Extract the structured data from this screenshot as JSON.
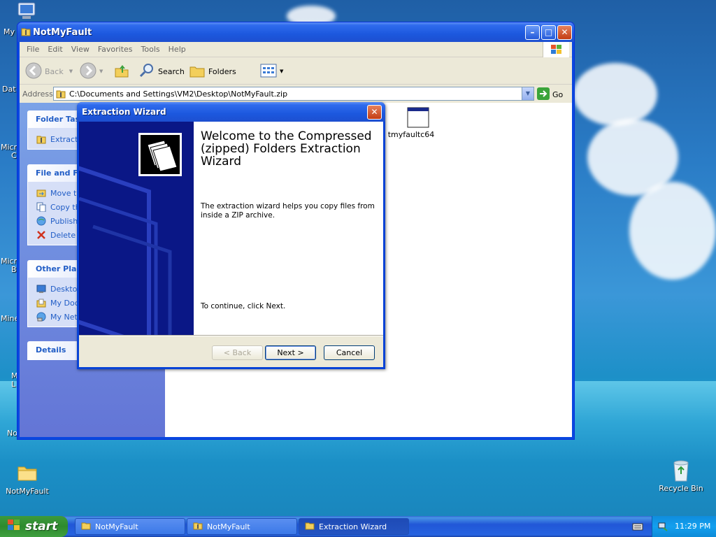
{
  "desktop": {
    "icons": {
      "my_computer_partial": "My",
      "data_partial": "Dat",
      "micro1_partial": "Micro",
      "micro1_line2_partial": "C",
      "micro2_partial": "Micro",
      "micro2_line2_partial": "B",
      "mine_partial": "Mine",
      "m_partial": "M",
      "l_partial": "L",
      "no_partial": "No",
      "notmyfault": "NotMyFault",
      "recycle_bin": "Recycle Bin"
    }
  },
  "explorer": {
    "title": "NotMyFault",
    "menu": [
      "File",
      "Edit",
      "View",
      "Favorites",
      "Tools",
      "Help"
    ],
    "toolbar": {
      "back": "Back",
      "search": "Search",
      "folders": "Folders"
    },
    "address": {
      "label": "Address",
      "value": "C:\\Documents and Settings\\VM2\\Desktop\\NotMyFault.zip",
      "go": "Go"
    },
    "left_panels": {
      "folder_tasks": {
        "title": "Folder Tas",
        "items": [
          "Extract"
        ]
      },
      "file_and_folder": {
        "title": "File and Fo",
        "items": [
          "Move th",
          "Copy th",
          "Publish",
          "Delete t"
        ]
      },
      "other_places": {
        "title": "Other Plac",
        "items": [
          "Desktop",
          "My Doc",
          "My Netw"
        ]
      },
      "details": {
        "title": "Details"
      }
    },
    "files": [
      "tmyfaultc64"
    ]
  },
  "wizard": {
    "title": "Extraction Wizard",
    "heading": "Welcome to the Compressed (zipped) Folders Extraction Wizard",
    "description": "The extraction wizard helps you copy files from inside a ZIP archive.",
    "continue_text": "To continue, click Next.",
    "buttons": {
      "back": "< Back",
      "next": "Next >",
      "cancel": "Cancel"
    }
  },
  "taskbar": {
    "start": "start",
    "tasks": [
      "NotMyFault",
      "NotMyFault",
      "Extraction Wizard"
    ],
    "time": "11:29 PM"
  },
  "colors": {
    "xp_blue": "#0a48e0",
    "panel_link": "#215dc6",
    "start_green": "#3c9a3c"
  }
}
